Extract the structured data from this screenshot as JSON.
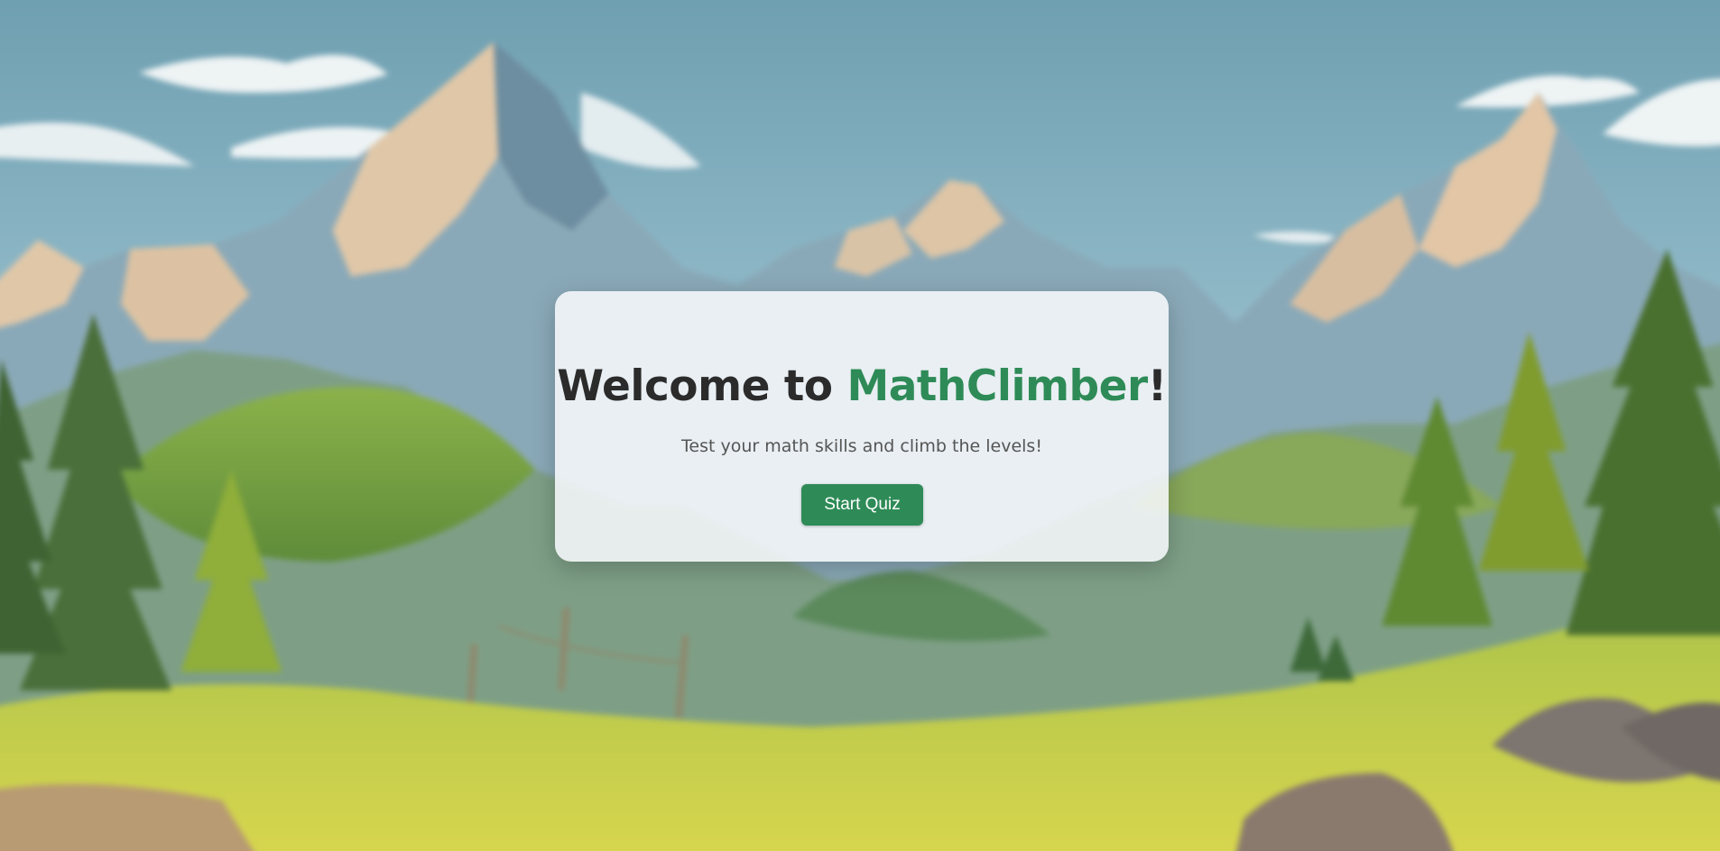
{
  "welcome": {
    "title_prefix": "Welcome to ",
    "brand": "MathClimber",
    "title_suffix": "!",
    "subtitle": "Test your math skills and climb the levels!",
    "start_label": "Start Quiz"
  },
  "colors": {
    "accent": "#2e8b57",
    "text": "#2b2b2b",
    "subtext": "#555555",
    "card": "#f6f8fa"
  }
}
